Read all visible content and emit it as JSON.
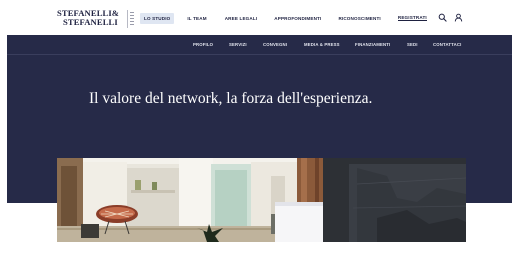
{
  "brand": {
    "line1": "STEFANELLI&",
    "line2": "STEFANELLI"
  },
  "main_nav": [
    {
      "label": "LO STUDIO",
      "active": true
    },
    {
      "label": "IL TEAM",
      "active": false
    },
    {
      "label": "AREE LEGALI",
      "active": false
    },
    {
      "label": "APPROFONDIMENTI",
      "active": false
    },
    {
      "label": "RICONOSCIMENTI",
      "active": false
    },
    {
      "label": "REGISTRATI",
      "active": false
    }
  ],
  "header_icons": [
    "search-icon",
    "user-icon"
  ],
  "sub_nav": [
    "PROFILO",
    "SERVIZI",
    "CONVEGNI",
    "MEDIA & PRESS",
    "FINANZIAMENTI",
    "SEDI",
    "CONTATTACI"
  ],
  "hero": {
    "title": "Il valore del network, la forza dell'esperienza."
  },
  "colors": {
    "navy": "#262a48",
    "brand_text": "#1e2140",
    "active_tab_bg": "#dfe6f2",
    "white": "#ffffff"
  }
}
